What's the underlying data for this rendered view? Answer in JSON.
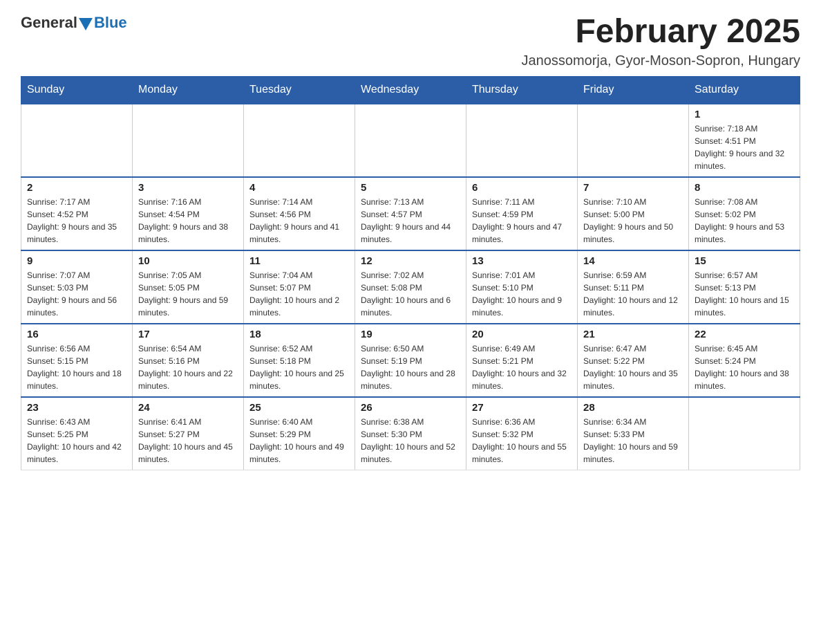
{
  "logo": {
    "general": "General",
    "blue": "Blue"
  },
  "header": {
    "title": "February 2025",
    "subtitle": "Janossomorja, Gyor-Moson-Sopron, Hungary"
  },
  "days_of_week": [
    "Sunday",
    "Monday",
    "Tuesday",
    "Wednesday",
    "Thursday",
    "Friday",
    "Saturday"
  ],
  "weeks": [
    [
      {
        "day": "",
        "sunrise": "",
        "sunset": "",
        "daylight": "",
        "empty": true
      },
      {
        "day": "",
        "sunrise": "",
        "sunset": "",
        "daylight": "",
        "empty": true
      },
      {
        "day": "",
        "sunrise": "",
        "sunset": "",
        "daylight": "",
        "empty": true
      },
      {
        "day": "",
        "sunrise": "",
        "sunset": "",
        "daylight": "",
        "empty": true
      },
      {
        "day": "",
        "sunrise": "",
        "sunset": "",
        "daylight": "",
        "empty": true
      },
      {
        "day": "",
        "sunrise": "",
        "sunset": "",
        "daylight": "",
        "empty": true
      },
      {
        "day": "1",
        "sunrise": "Sunrise: 7:18 AM",
        "sunset": "Sunset: 4:51 PM",
        "daylight": "Daylight: 9 hours and 32 minutes.",
        "empty": false
      }
    ],
    [
      {
        "day": "2",
        "sunrise": "Sunrise: 7:17 AM",
        "sunset": "Sunset: 4:52 PM",
        "daylight": "Daylight: 9 hours and 35 minutes.",
        "empty": false
      },
      {
        "day": "3",
        "sunrise": "Sunrise: 7:16 AM",
        "sunset": "Sunset: 4:54 PM",
        "daylight": "Daylight: 9 hours and 38 minutes.",
        "empty": false
      },
      {
        "day": "4",
        "sunrise": "Sunrise: 7:14 AM",
        "sunset": "Sunset: 4:56 PM",
        "daylight": "Daylight: 9 hours and 41 minutes.",
        "empty": false
      },
      {
        "day": "5",
        "sunrise": "Sunrise: 7:13 AM",
        "sunset": "Sunset: 4:57 PM",
        "daylight": "Daylight: 9 hours and 44 minutes.",
        "empty": false
      },
      {
        "day": "6",
        "sunrise": "Sunrise: 7:11 AM",
        "sunset": "Sunset: 4:59 PM",
        "daylight": "Daylight: 9 hours and 47 minutes.",
        "empty": false
      },
      {
        "day": "7",
        "sunrise": "Sunrise: 7:10 AM",
        "sunset": "Sunset: 5:00 PM",
        "daylight": "Daylight: 9 hours and 50 minutes.",
        "empty": false
      },
      {
        "day": "8",
        "sunrise": "Sunrise: 7:08 AM",
        "sunset": "Sunset: 5:02 PM",
        "daylight": "Daylight: 9 hours and 53 minutes.",
        "empty": false
      }
    ],
    [
      {
        "day": "9",
        "sunrise": "Sunrise: 7:07 AM",
        "sunset": "Sunset: 5:03 PM",
        "daylight": "Daylight: 9 hours and 56 minutes.",
        "empty": false
      },
      {
        "day": "10",
        "sunrise": "Sunrise: 7:05 AM",
        "sunset": "Sunset: 5:05 PM",
        "daylight": "Daylight: 9 hours and 59 minutes.",
        "empty": false
      },
      {
        "day": "11",
        "sunrise": "Sunrise: 7:04 AM",
        "sunset": "Sunset: 5:07 PM",
        "daylight": "Daylight: 10 hours and 2 minutes.",
        "empty": false
      },
      {
        "day": "12",
        "sunrise": "Sunrise: 7:02 AM",
        "sunset": "Sunset: 5:08 PM",
        "daylight": "Daylight: 10 hours and 6 minutes.",
        "empty": false
      },
      {
        "day": "13",
        "sunrise": "Sunrise: 7:01 AM",
        "sunset": "Sunset: 5:10 PM",
        "daylight": "Daylight: 10 hours and 9 minutes.",
        "empty": false
      },
      {
        "day": "14",
        "sunrise": "Sunrise: 6:59 AM",
        "sunset": "Sunset: 5:11 PM",
        "daylight": "Daylight: 10 hours and 12 minutes.",
        "empty": false
      },
      {
        "day": "15",
        "sunrise": "Sunrise: 6:57 AM",
        "sunset": "Sunset: 5:13 PM",
        "daylight": "Daylight: 10 hours and 15 minutes.",
        "empty": false
      }
    ],
    [
      {
        "day": "16",
        "sunrise": "Sunrise: 6:56 AM",
        "sunset": "Sunset: 5:15 PM",
        "daylight": "Daylight: 10 hours and 18 minutes.",
        "empty": false
      },
      {
        "day": "17",
        "sunrise": "Sunrise: 6:54 AM",
        "sunset": "Sunset: 5:16 PM",
        "daylight": "Daylight: 10 hours and 22 minutes.",
        "empty": false
      },
      {
        "day": "18",
        "sunrise": "Sunrise: 6:52 AM",
        "sunset": "Sunset: 5:18 PM",
        "daylight": "Daylight: 10 hours and 25 minutes.",
        "empty": false
      },
      {
        "day": "19",
        "sunrise": "Sunrise: 6:50 AM",
        "sunset": "Sunset: 5:19 PM",
        "daylight": "Daylight: 10 hours and 28 minutes.",
        "empty": false
      },
      {
        "day": "20",
        "sunrise": "Sunrise: 6:49 AM",
        "sunset": "Sunset: 5:21 PM",
        "daylight": "Daylight: 10 hours and 32 minutes.",
        "empty": false
      },
      {
        "day": "21",
        "sunrise": "Sunrise: 6:47 AM",
        "sunset": "Sunset: 5:22 PM",
        "daylight": "Daylight: 10 hours and 35 minutes.",
        "empty": false
      },
      {
        "day": "22",
        "sunrise": "Sunrise: 6:45 AM",
        "sunset": "Sunset: 5:24 PM",
        "daylight": "Daylight: 10 hours and 38 minutes.",
        "empty": false
      }
    ],
    [
      {
        "day": "23",
        "sunrise": "Sunrise: 6:43 AM",
        "sunset": "Sunset: 5:25 PM",
        "daylight": "Daylight: 10 hours and 42 minutes.",
        "empty": false
      },
      {
        "day": "24",
        "sunrise": "Sunrise: 6:41 AM",
        "sunset": "Sunset: 5:27 PM",
        "daylight": "Daylight: 10 hours and 45 minutes.",
        "empty": false
      },
      {
        "day": "25",
        "sunrise": "Sunrise: 6:40 AM",
        "sunset": "Sunset: 5:29 PM",
        "daylight": "Daylight: 10 hours and 49 minutes.",
        "empty": false
      },
      {
        "day": "26",
        "sunrise": "Sunrise: 6:38 AM",
        "sunset": "Sunset: 5:30 PM",
        "daylight": "Daylight: 10 hours and 52 minutes.",
        "empty": false
      },
      {
        "day": "27",
        "sunrise": "Sunrise: 6:36 AM",
        "sunset": "Sunset: 5:32 PM",
        "daylight": "Daylight: 10 hours and 55 minutes.",
        "empty": false
      },
      {
        "day": "28",
        "sunrise": "Sunrise: 6:34 AM",
        "sunset": "Sunset: 5:33 PM",
        "daylight": "Daylight: 10 hours and 59 minutes.",
        "empty": false
      },
      {
        "day": "",
        "sunrise": "",
        "sunset": "",
        "daylight": "",
        "empty": true
      }
    ]
  ]
}
